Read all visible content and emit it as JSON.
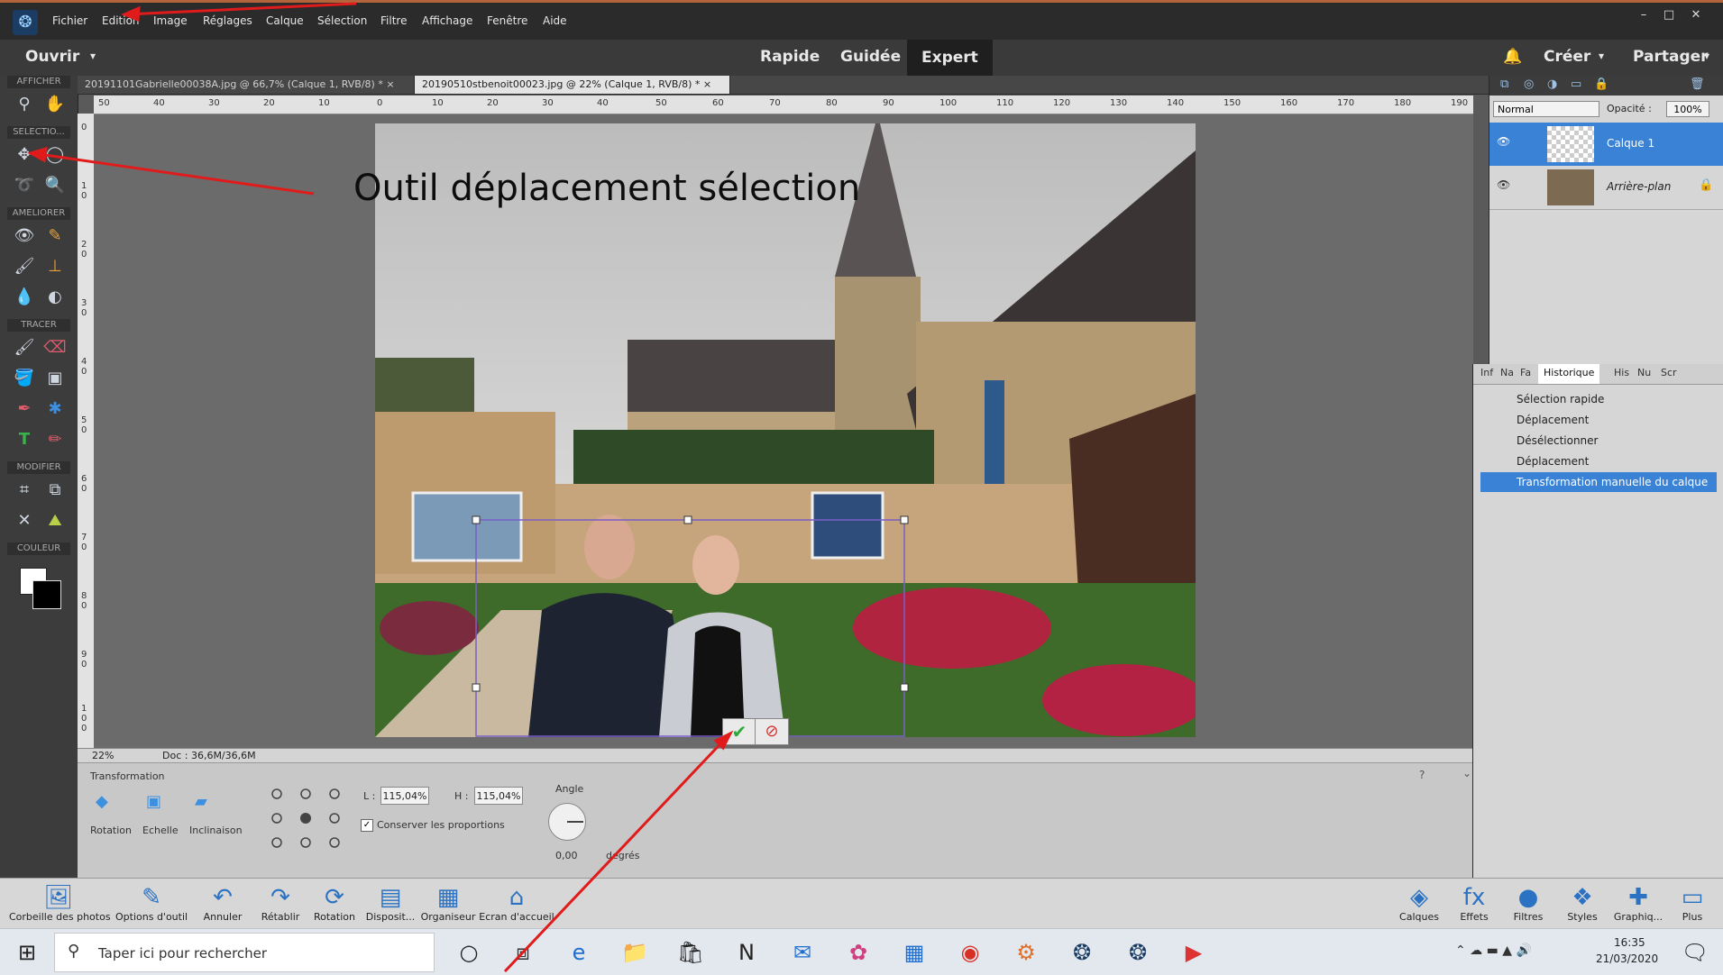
{
  "menubar": {
    "items": [
      "Fichier",
      "Edition",
      "Image",
      "Réglages",
      "Calque",
      "Sélection",
      "Filtre",
      "Affichage",
      "Fenêtre",
      "Aide"
    ],
    "window_controls": [
      "–",
      "□",
      "✕"
    ]
  },
  "appbar": {
    "open_label": "Ouvrir",
    "modes": [
      "Rapide",
      "Guidée",
      "Expert"
    ],
    "active_mode": "Expert",
    "create_label": "Créer",
    "share_label": "Partager"
  },
  "toolbar": {
    "sections": [
      "AFFICHER",
      "SELECTIO...",
      "AMELIORER",
      "TRACER",
      "MODIFIER",
      "COULEUR"
    ]
  },
  "doc_tabs": [
    "20191101Gabrielle00038A.jpg @ 66,7% (Calque 1, RVB/8) * ×",
    "20190510stbenoit00023.jpg @ 22% (Calque 1, RVB/8) * ×"
  ],
  "ruler": {
    "top_ticks": [
      "50",
      "40",
      "30",
      "20",
      "10",
      "0",
      "10",
      "20",
      "30",
      "40",
      "50",
      "60",
      "70",
      "80",
      "90",
      "100",
      "110",
      "120",
      "130",
      "140",
      "150",
      "160",
      "170",
      "180",
      "190"
    ],
    "left_ticks": [
      "0",
      "1 0",
      "2 0",
      "3 0",
      "4 0",
      "5 0",
      "6 0",
      "7 0",
      "8 0",
      "9 0",
      "1 0 0"
    ]
  },
  "status": {
    "zoom": "22%",
    "doc": "Doc : 36,6M/36,6M"
  },
  "options": {
    "title": "Transformation",
    "modes": [
      "Rotation",
      "Echelle",
      "Inclinaison"
    ],
    "width_label": "L :",
    "width_value": "115,04%",
    "height_label": "H :",
    "height_value": "115,04%",
    "keep_ratio_label": "Conserver les proportions",
    "angle_label": "Angle",
    "angle_value": "0,00",
    "angle_unit": "degrés"
  },
  "layers": {
    "blend_mode": "Normal",
    "opacity_label": "Opacité :",
    "opacity_value": "100%",
    "items": [
      {
        "name": "Calque 1",
        "selected": true
      },
      {
        "name": "Arrière-plan",
        "selected": false
      }
    ]
  },
  "history": {
    "tabs": [
      "Inf",
      "Na",
      "Fa",
      "Historique",
      "His",
      "Nu",
      "Scr"
    ],
    "active_tab": "Historique",
    "items": [
      "Sélection rapide",
      "Déplacement",
      "Désélectionner",
      "Déplacement",
      "Transformation manuelle du calque"
    ],
    "selected_index": 4
  },
  "bottombar": {
    "left": [
      "Corbeille des photos",
      "Options d'outil",
      "Annuler",
      "Rétablir",
      "Rotation",
      "Disposit...",
      "Organiseur",
      "Ecran d'accueil"
    ],
    "right": [
      "Calques",
      "Effets",
      "Filtres",
      "Styles",
      "Graphiq...",
      "Plus"
    ]
  },
  "taskbar": {
    "search_placeholder": "Taper ici pour rechercher",
    "time": "16:35",
    "date": "21/03/2020"
  },
  "annotation": {
    "text": "Outil déplacement sélection",
    "arrow_color": "#e01b1b"
  }
}
